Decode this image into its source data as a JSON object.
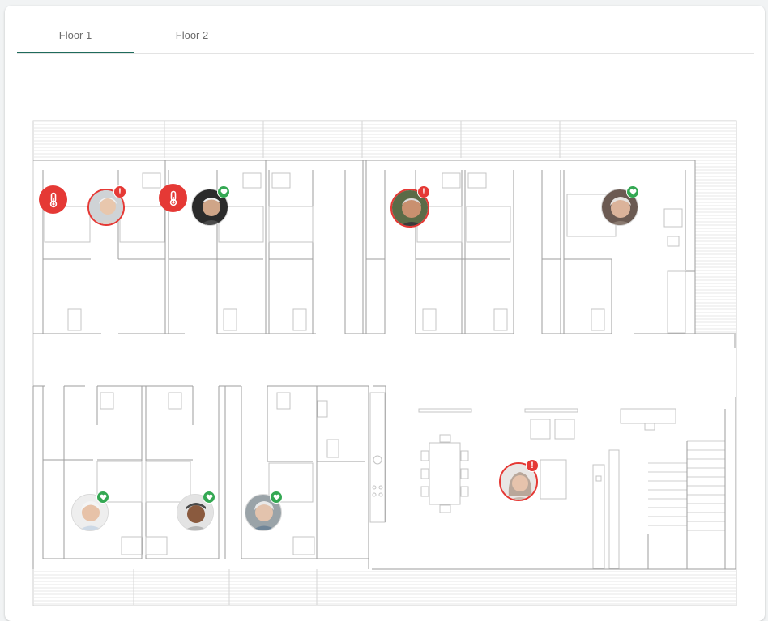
{
  "tabs": [
    {
      "label": "Floor 1",
      "active": true
    },
    {
      "label": "Floor 2",
      "active": false
    }
  ],
  "colors": {
    "accent": "#1f6b5c",
    "alert": "#e53935",
    "ok": "#34a853",
    "wall": "#9e9e9e"
  },
  "icons": {
    "temperature": "thermometer-icon",
    "alert_badge": "exclamation-icon",
    "ok_badge": "heart-icon"
  },
  "badge_text": {
    "alert": "!"
  },
  "residents": [
    {
      "id": "r1",
      "status": "alert"
    },
    {
      "id": "r2",
      "status": "ok"
    },
    {
      "id": "r3",
      "status": "alert"
    },
    {
      "id": "r4",
      "status": "ok"
    },
    {
      "id": "r5",
      "status": "ok"
    },
    {
      "id": "r6",
      "status": "ok"
    },
    {
      "id": "r7",
      "status": "ok"
    },
    {
      "id": "r8",
      "status": "alert"
    }
  ],
  "temperature_alerts": [
    {
      "id": "t1",
      "status": "alert"
    },
    {
      "id": "t2",
      "status": "alert"
    }
  ]
}
